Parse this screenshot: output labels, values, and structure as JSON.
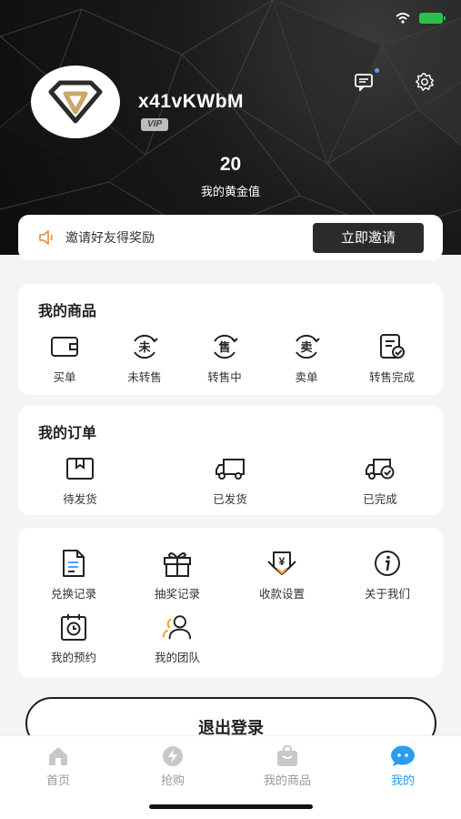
{
  "profile": {
    "username": "x41vKWbM",
    "badge": "VIP",
    "gold_value": "20",
    "gold_label": "我的黄金值"
  },
  "invite": {
    "label": "邀请好友得奖励",
    "button": "立即邀请"
  },
  "my_goods": {
    "title": "我的商品",
    "items": [
      {
        "label": "买单",
        "icon": "wallet-icon"
      },
      {
        "label": "未转售",
        "icon": "unsold-icon",
        "glyph": "未"
      },
      {
        "label": "转售中",
        "icon": "reselling-icon",
        "glyph": "售"
      },
      {
        "label": "卖单",
        "icon": "sell-order-icon",
        "glyph": "卖"
      },
      {
        "label": "转售完成",
        "icon": "resale-done-icon"
      }
    ]
  },
  "my_orders": {
    "title": "我的订单",
    "items": [
      {
        "label": "待发货",
        "icon": "package-icon"
      },
      {
        "label": "已发货",
        "icon": "truck-icon"
      },
      {
        "label": "已完成",
        "icon": "truck-check-icon"
      }
    ]
  },
  "services": {
    "items": [
      {
        "label": "兑换记录",
        "icon": "document-icon"
      },
      {
        "label": "抽奖记录",
        "icon": "gift-icon"
      },
      {
        "label": "收款设置",
        "icon": "payment-icon",
        "glyph": "¥"
      },
      {
        "label": "关于我们",
        "icon": "info-icon"
      },
      {
        "label": "我的预约",
        "icon": "reservation-icon"
      },
      {
        "label": "我的团队",
        "icon": "team-icon"
      }
    ]
  },
  "logout_label": "退出登录",
  "tabs": [
    {
      "label": "首页",
      "icon": "home-icon"
    },
    {
      "label": "抢购",
      "icon": "flash-icon"
    },
    {
      "label": "我的商品",
      "icon": "bag-icon"
    },
    {
      "label": "我的",
      "icon": "chat-bubble-icon",
      "active": true
    }
  ],
  "colors": {
    "accent": "#2c9cf0",
    "gold": "#c9a86a",
    "dark": "#1e1e1e",
    "battery": "#27c24c"
  }
}
